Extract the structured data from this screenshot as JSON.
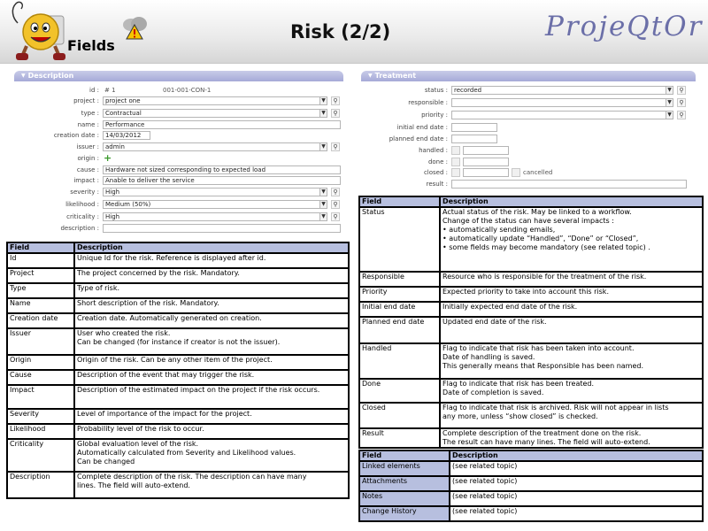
{
  "header": {
    "fields_label": "Fields",
    "title": "Risk (2/2)",
    "logo_text": "ProjeQtOr",
    "mascot_icon": "smiley-mascot-icon",
    "cloud_icon": "warning-cloud-icon"
  },
  "description_section": {
    "title": "Description",
    "id_label": "id :",
    "id_hash": "# 1",
    "id_ref": "001-001-CON-1",
    "project_label": "project :",
    "project_value": "project one",
    "type_label": "type :",
    "type_value": "Contractual",
    "name_label": "name :",
    "name_value": "Performance",
    "creation_date_label": "creation date :",
    "creation_date_value": "14/03/2012",
    "issuer_label": "issuer :",
    "issuer_value": "admin",
    "origin_label": "origin :",
    "cause_label": "cause :",
    "cause_value": "Hardware not sized corresponding to expected load",
    "impact_label": "impact :",
    "impact_value": "Anable to deliver the service",
    "severity_label": "severity :",
    "severity_value": "High",
    "likelihood_label": "likelihood :",
    "likelihood_value": "Medium (50%)",
    "criticality_label": "criticality :",
    "criticality_value": "High",
    "description_label": "description :"
  },
  "treatment_section": {
    "title": "Treatment",
    "status_label": "status :",
    "status_value": "recorded",
    "responsible_label": "responsible :",
    "priority_label": "priority :",
    "initial_end_date_label": "initial end date :",
    "planned_end_date_label": "planned end date :",
    "handled_label": "handled :",
    "done_label": "done :",
    "closed_label": "closed :",
    "cancelled_label": "cancelled",
    "result_label": "result :"
  },
  "left_table": {
    "header_field": "Field",
    "header_desc": "Description",
    "rows": [
      {
        "f": "Id",
        "d": "Unique Id for the risk. Reference is displayed after id."
      },
      {
        "f": "Project",
        "d": "The project concerned by the risk. Mandatory."
      },
      {
        "f": "Type",
        "d": "Type of risk."
      },
      {
        "f": "Name",
        "d": "Short description of the risk. Mandatory."
      },
      {
        "f": "Creation date",
        "d": "Creation date. Automatically generated on creation."
      },
      {
        "f": "Issuer",
        "d": "User who created the risk.\nCan be changed (for instance if creator is not the issuer)."
      },
      {
        "f": "Origin",
        "d": "Origin of the risk. Can be any other item of the project."
      },
      {
        "f": "Cause",
        "d": "Description of the event that may trigger the risk."
      },
      {
        "f": "Impact",
        "d": "Description of the estimated impact on the project if the risk occurs."
      },
      {
        "f": "Severity",
        "d": "Level of importance of the impact for the project."
      },
      {
        "f": "Likelihood",
        "d": "Probability level of the risk to occur."
      },
      {
        "f": "Criticality",
        "d": "Global evaluation level of the risk.\nAutomatically calculated from Severity and Likelihood values.\nCan be changed"
      },
      {
        "f": "Description",
        "d": "Complete description of the risk. The description can have many\nlines. The field will auto-extend."
      }
    ]
  },
  "right_table": {
    "header_field": "Field",
    "header_desc": "Description",
    "rows": [
      {
        "f": "Status",
        "d": "Actual status of the risk. May be linked to a workflow.\nChange of the status can have several impacts :\n• automatically sending emails,\n• automatically update “Handled”, “Done” or “Closed”,\n• some fields may become mandatory (see related topic) ."
      },
      {
        "f": "Responsible",
        "d": "Resource who is responsible for the treatment of the risk."
      },
      {
        "f": "Priority",
        "d": "Expected priority to take into account this risk."
      },
      {
        "f": "Initial end date",
        "d": "Initially expected end date of the risk."
      },
      {
        "f": "Planned end date",
        "d": "Updated end date of the risk."
      },
      {
        "f": "Handled",
        "d": "Flag to indicate that risk has been taken into account.\nDate of handling is saved.\nThis generally means that Responsible has been named."
      },
      {
        "f": "Done",
        "d": "Flag to indicate that risk has been treated.\nDate of completion is saved."
      },
      {
        "f": "Closed",
        "d": "Flag to indicate that risk is archived. Risk will not appear in lists\nany more, unless “show closed” is checked."
      },
      {
        "f": "Result",
        "d": "Complete description of the treatment done on the risk.\nThe result can have many lines. The field will auto-extend."
      }
    ]
  },
  "bottom_table": {
    "header_field": "Field",
    "header_desc": "Description",
    "rows": [
      {
        "f": "Linked elements",
        "d": "(see related topic)"
      },
      {
        "f": "Attachments",
        "d": "(see related topic)"
      },
      {
        "f": "Notes",
        "d": "(see related topic)"
      },
      {
        "f": "Change History",
        "d": "(see related topic)"
      }
    ]
  }
}
